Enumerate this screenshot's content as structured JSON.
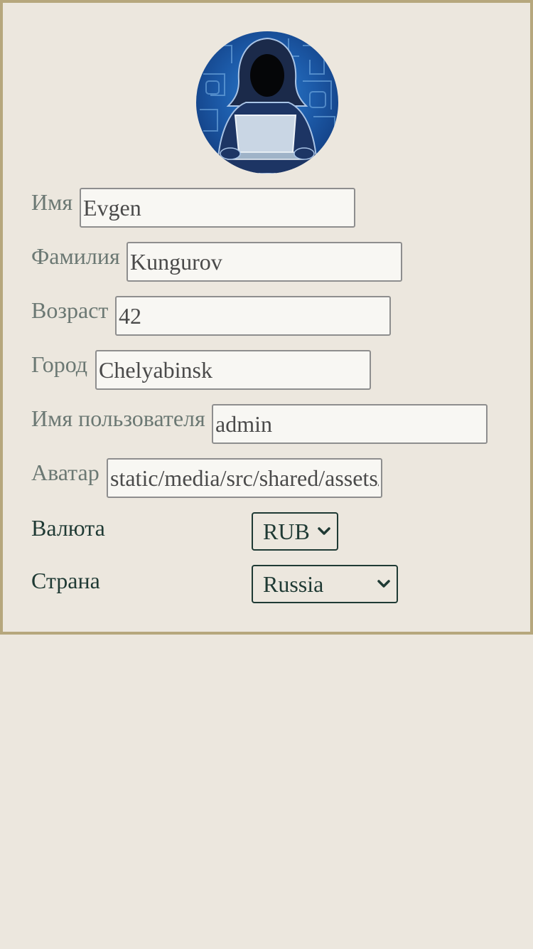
{
  "profile": {
    "avatar_icon": "hacker-avatar-icon",
    "fields": [
      {
        "label": "Имя",
        "value": "Evgen"
      },
      {
        "label": "Фамилия",
        "value": "Kungurov"
      },
      {
        "label": "Возраст",
        "value": "42"
      },
      {
        "label": "Город",
        "value": "Chelyabinsk"
      },
      {
        "label": "Имя пользователя",
        "value": "admin"
      },
      {
        "label": "Аватар",
        "value": "static/media/src/shared/assets/"
      }
    ],
    "currency": {
      "label": "Валюта",
      "selected": "RUB"
    },
    "country": {
      "label": "Страна",
      "selected": "Russia"
    }
  },
  "colors": {
    "background": "#ece7de",
    "border": "#b6a77d",
    "label_muted": "#6b7873",
    "label_dark": "#1f3a34"
  }
}
